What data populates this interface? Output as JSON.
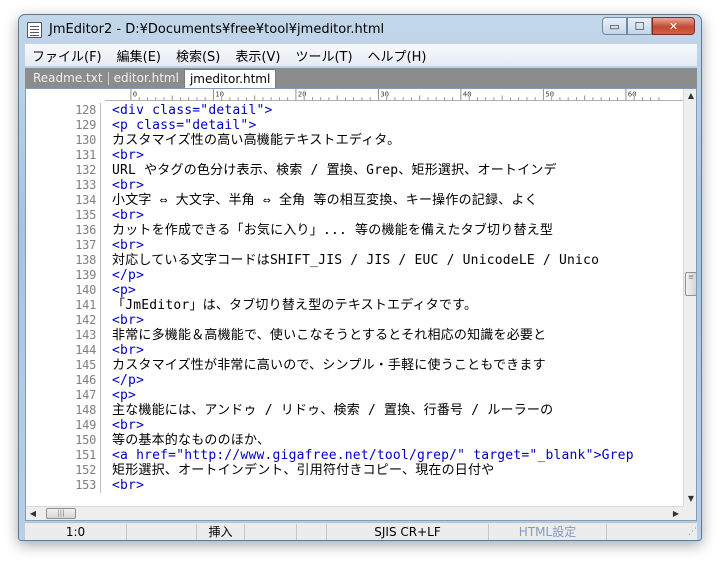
{
  "window": {
    "title": "JmEditor2 - D:¥Documents¥free¥tool¥jmeditor.html",
    "controls": {
      "minimize": "▭",
      "maximize": "☐",
      "close": "✕"
    }
  },
  "menu": [
    {
      "label": "ファイル(F)"
    },
    {
      "label": "編集(E)"
    },
    {
      "label": "検索(S)"
    },
    {
      "label": "表示(V)"
    },
    {
      "label": "ツール(T)"
    },
    {
      "label": "ヘルプ(H)"
    }
  ],
  "tabs": [
    {
      "label": "Readme.txt",
      "active": false
    },
    {
      "label": "editor.html",
      "active": false
    },
    {
      "label": "jmeditor.html",
      "active": true
    }
  ],
  "ruler": {
    "marks": [
      "0",
      "10",
      "20",
      "30",
      "40",
      "50",
      "60"
    ]
  },
  "lines": [
    {
      "num": "128",
      "text": "<div class=\"detail\">",
      "kind": "tag"
    },
    {
      "num": "129",
      "text": "<p class=\"detail\">",
      "kind": "tag"
    },
    {
      "num": "130",
      "text": "カスタマイズ性の高い高機能テキストエディタ。",
      "kind": "text"
    },
    {
      "num": "131",
      "text": "<br>",
      "kind": "tag"
    },
    {
      "num": "132",
      "text": "URL やタグの色分け表示、検索 / 置換、Grep、矩形選択、オートインデ",
      "kind": "text"
    },
    {
      "num": "133",
      "text": "<br>",
      "kind": "tag"
    },
    {
      "num": "134",
      "text": "小文字 ⇔ 大文字、半角 ⇔ 全角 等の相互変換、キー操作の記録、よく",
      "kind": "text"
    },
    {
      "num": "135",
      "text": "<br>",
      "kind": "tag"
    },
    {
      "num": "136",
      "text": "カットを作成できる「お気に入り」... 等の機能を備えたタブ切り替え型",
      "kind": "text"
    },
    {
      "num": "137",
      "text": "<br>",
      "kind": "tag"
    },
    {
      "num": "138",
      "text": "対応している文字コードはSHIFT_JIS / JIS / EUC / UnicodeLE / Unico",
      "kind": "text"
    },
    {
      "num": "139",
      "text": "</p>",
      "kind": "tag"
    },
    {
      "num": "140",
      "text": "<p>",
      "kind": "tag"
    },
    {
      "num": "141",
      "text": "「JmEditor」は、タブ切り替え型のテキストエディタです。",
      "kind": "text"
    },
    {
      "num": "142",
      "text": "<br>",
      "kind": "tag"
    },
    {
      "num": "143",
      "text": "非常に多機能＆高機能で、使いこなそうとするとそれ相応の知識を必要と",
      "kind": "text"
    },
    {
      "num": "144",
      "text": "<br>",
      "kind": "tag"
    },
    {
      "num": "145",
      "text": "カスタマイズ性が非常に高いので、シンプル・手軽に使うこともできます",
      "kind": "text"
    },
    {
      "num": "146",
      "text": "</p>",
      "kind": "tag"
    },
    {
      "num": "147",
      "text": "<p>",
      "kind": "tag"
    },
    {
      "num": "148",
      "text": "主な機能には、アンドゥ / リドゥ、検索 / 置換、行番号 / ルーラーの",
      "kind": "text"
    },
    {
      "num": "149",
      "text": "<br>",
      "kind": "tag"
    },
    {
      "num": "150",
      "text": "等の基本的なもののほか、",
      "kind": "text"
    },
    {
      "num": "151",
      "text": "<a href=\"http://www.gigafree.net/tool/grep/\" target=\"_blank\">Grep",
      "kind": "tag"
    },
    {
      "num": "152",
      "text": "矩形選択、オートインデント、引用符付きコピー、現在の日付や",
      "kind": "text"
    },
    {
      "num": "153",
      "text": "<br>",
      "kind": "tag"
    }
  ],
  "status": {
    "position": "1:0",
    "mode": "挿入",
    "encoding": "SJIS CR+LF",
    "filetype": "HTML設定"
  },
  "colors": {
    "tag": "#0000c8",
    "line_number": "#808080",
    "tabbar": "#8c8c8c"
  }
}
